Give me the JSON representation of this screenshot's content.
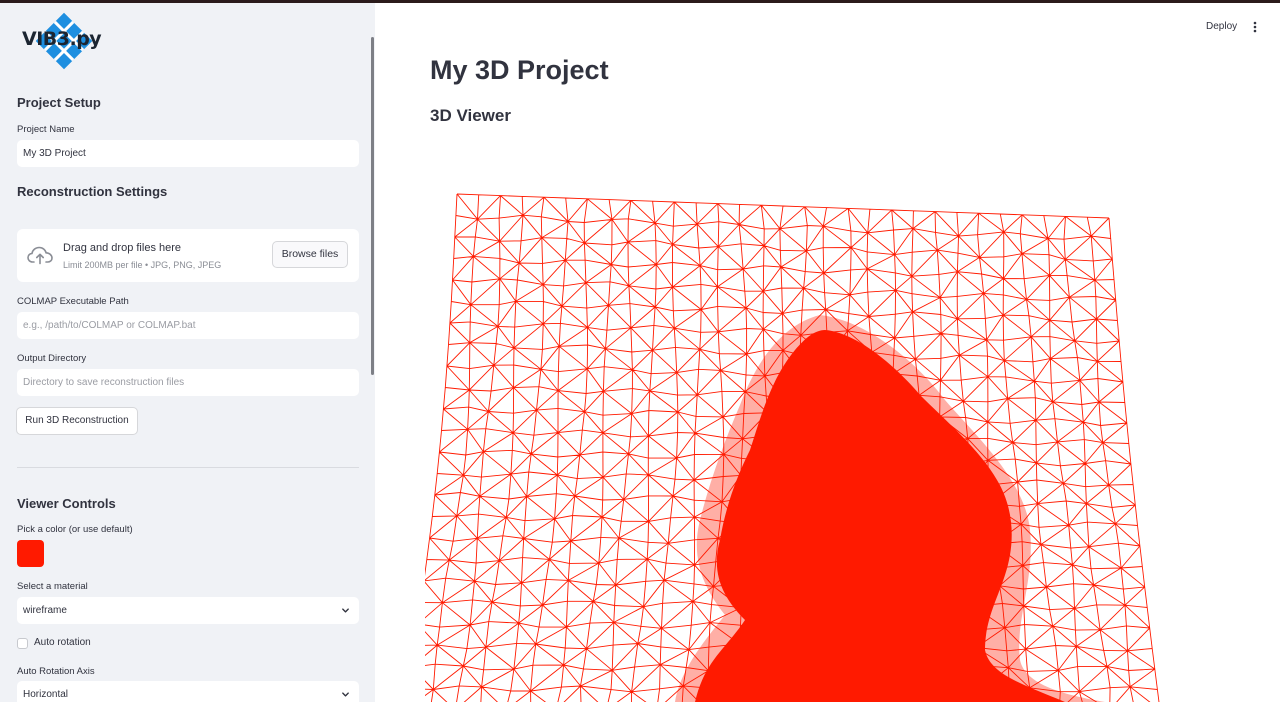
{
  "sidebar": {
    "logo_text": "VIB3.py",
    "project_setup": {
      "heading": "Project Setup",
      "project_name_label": "Project Name",
      "project_name_value": "My 3D Project"
    },
    "reconstruction": {
      "heading": "Reconstruction Settings",
      "uploader_title": "Drag and drop files here",
      "uploader_subtitle": "Limit 200MB per file • JPG, PNG, JPEG",
      "browse_label": "Browse files",
      "colmap_label": "COLMAP Executable Path",
      "colmap_placeholder": "e.g., /path/to/COLMAP or COLMAP.bat",
      "output_label": "Output Directory",
      "output_placeholder": "Directory to save reconstruction files",
      "run_label": "Run 3D Reconstruction"
    },
    "viewer_controls": {
      "heading": "Viewer Controls",
      "color_label": "Pick a color (or use default)",
      "color_value": "#ff1a00",
      "material_label": "Select a material",
      "material_value": "wireframe",
      "auto_rotation_label": "Auto rotation",
      "auto_rotation_checked": false,
      "axis_label": "Auto Rotation Axis",
      "axis_value": "Horizontal"
    }
  },
  "header": {
    "deploy_label": "Deploy",
    "menu_icon": "kebab-menu-icon"
  },
  "main": {
    "title": "My 3D Project",
    "viewer_heading": "3D Viewer",
    "mesh_color": "#ff1a00",
    "mesh_style": "wireframe"
  },
  "colors": {
    "sidebar_bg": "#f0f2f6",
    "text": "#31333f",
    "accent": "#ff1a00"
  }
}
